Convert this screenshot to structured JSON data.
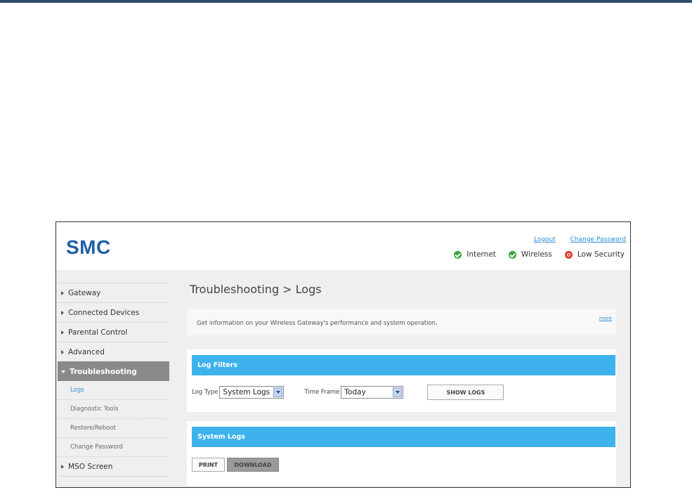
{
  "brand": {
    "logo": "SMC"
  },
  "top_links": {
    "logout": "Logout",
    "change_password": "Change Password"
  },
  "status": [
    {
      "label": "Internet",
      "state": "ok",
      "icon": "check-circle-icon",
      "color": "#3aa53a"
    },
    {
      "label": "Wireless",
      "state": "ok",
      "icon": "check-circle-icon",
      "color": "#3aa53a"
    },
    {
      "label": "Low Security",
      "state": "warning",
      "icon": "lifebuoy-icon",
      "color": "#d8402a"
    }
  ],
  "sidebar": {
    "items": [
      {
        "label": "Gateway"
      },
      {
        "label": "Connected Devices"
      },
      {
        "label": "Parental Control"
      },
      {
        "label": "Advanced"
      },
      {
        "label": "Troubleshooting",
        "active": true
      },
      {
        "label": "MSO Screen"
      }
    ],
    "subitems": [
      {
        "label": "Logs",
        "selected": true
      },
      {
        "label": "Diagnostic Tools"
      },
      {
        "label": "Restore/Reboot"
      },
      {
        "label": "Change Password"
      }
    ]
  },
  "main": {
    "title": "Troubleshooting > Logs",
    "info_text": "Get information on your Wireless Gateway's performance and system operation.",
    "more_link": "more",
    "log_filters": {
      "heading": "Log Filters",
      "log_type_label": "Log Type",
      "log_type_value": "System Logs",
      "time_frame_label": "Time Frame",
      "time_frame_value": "Today",
      "show_button": "SHOW LOGS"
    },
    "system_logs": {
      "heading": "System Logs",
      "print_button": "PRINT",
      "download_button": "DOWNLOAD"
    }
  },
  "colors": {
    "accent": "#3db2ec",
    "brand": "#1f5fa8",
    "link": "#2a8fd6",
    "topbar": "#2e4a6a"
  }
}
